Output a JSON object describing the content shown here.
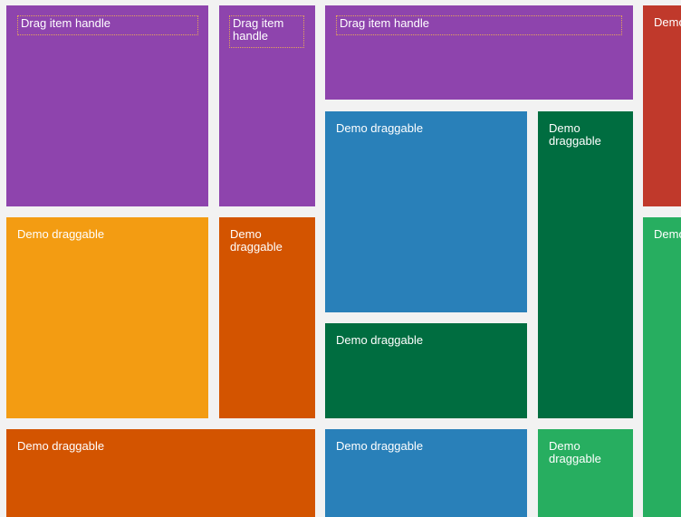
{
  "colors": {
    "purple": "#8e44ad",
    "red": "#c0392b",
    "blue": "#2980b9",
    "dark_green": "#006d40",
    "green": "#27ae60",
    "yellow": "#f39c12",
    "orange": "#d35400",
    "background": "#f2f2f2"
  },
  "tiles": [
    {
      "label": "Drag item handle",
      "has_handle": true,
      "color": "#8e44ad"
    },
    {
      "label": "Drag item handle",
      "has_handle": true,
      "color": "#8e44ad"
    },
    {
      "label": "Drag item handle",
      "has_handle": true,
      "color": "#8e44ad"
    },
    {
      "label": "Demo",
      "has_handle": false,
      "color": "#c0392b"
    },
    {
      "label": "Demo draggable",
      "has_handle": false,
      "color": "#2980b9"
    },
    {
      "label": "Demo draggable",
      "has_handle": false,
      "color": "#006d40"
    },
    {
      "label": "Demo draggable",
      "has_handle": false,
      "color": "#f39c12"
    },
    {
      "label": "Demo draggable",
      "has_handle": false,
      "color": "#d35400"
    },
    {
      "label": "Demo",
      "has_handle": false,
      "color": "#27ae60"
    },
    {
      "label": "Demo draggable",
      "has_handle": false,
      "color": "#006d40"
    },
    {
      "label": "Demo draggable",
      "has_handle": false,
      "color": "#d35400"
    },
    {
      "label": "Demo draggable",
      "has_handle": false,
      "color": "#2980b9"
    },
    {
      "label": "Demo draggable",
      "has_handle": false,
      "color": "#27ae60"
    }
  ]
}
